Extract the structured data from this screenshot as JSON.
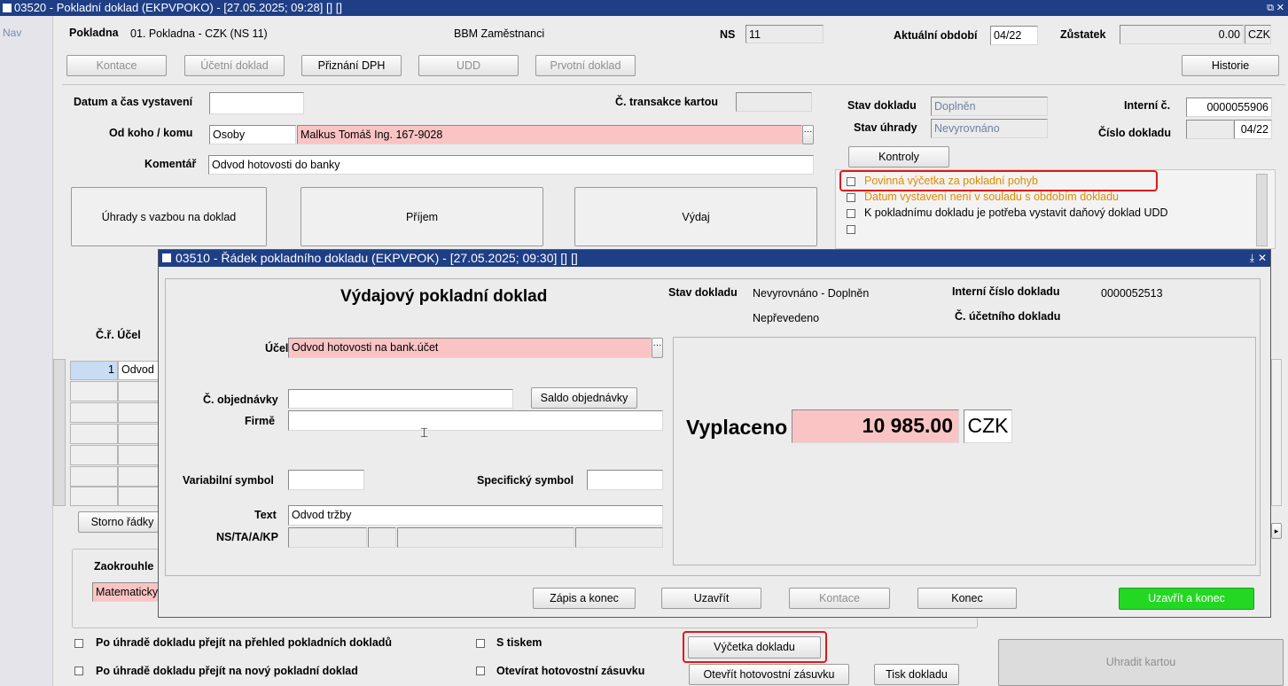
{
  "main": {
    "title": "03520 - Pokladní doklad (EKPVPOKO) - [27.05.2025; 09:28] [] []",
    "nav_label": "Nav",
    "pokladna_label": "Pokladna",
    "pokladna_value": "01. Pokladna - CZK (NS 11)",
    "group_value": "BBM Zaměstnanci",
    "ns_label": "NS",
    "ns_value": "11",
    "period_label": "Aktuální období",
    "period_value": "04/22",
    "balance_label": "Zůstatek",
    "balance_value": "0.00",
    "balance_currency": "CZK",
    "buttons": {
      "kontace": "Kontace",
      "ucetni_doklad": "Účetní doklad",
      "priznani_dph": "Přiznání DPH",
      "udd": "UDD",
      "prvotni_doklad": "Prvotní doklad",
      "historie": "Historie",
      "kontroly": "Kontroly",
      "uhrady": "Úhrady s vazbou na doklad",
      "prijem": "Příjem",
      "vydaj": "Výdaj",
      "storno": "Storno řádky",
      "vycetka": "Výčetka dokladu",
      "otevrit_zasuvku": "Otevřít hotovostní zásuvku",
      "tisk": "Tisk dokladu",
      "uhradit_kartou": "Uhradit kartou"
    },
    "datum_label": "Datum a čas vystavení",
    "datum_value": "",
    "transakce_label": "Č. transakce kartou",
    "od_koho_label": "Od koho / komu",
    "od_koho_type": "Osoby",
    "od_koho_value": "Malkus Tomáš Ing. 167-9028",
    "komentar_label": "Komentář",
    "komentar_value": "Odvod hotovosti do banky",
    "stav_dokladu_label": "Stav dokladu",
    "stav_dokladu_value": "Doplněn",
    "stav_uhrady_label": "Stav úhrady",
    "stav_uhrady_value": "Nevyrovnáno",
    "interni_label": "Interní č.",
    "interni_value": "0000055906",
    "cislo_label": "Číslo dokladu",
    "cislo_value": "04/22",
    "checks": [
      "Povinná výčetka za pokladní pohyb",
      "Datum vystavení není v souladu s obdobím dokladu",
      "K pokladnímu dokladu je potřeba vystavit daňový doklad UDD"
    ],
    "grid_header": "Č.ř. Účel",
    "grid_row1_no": "1",
    "grid_row1_text": "Odvod",
    "zaokrouhleni_label": "Zaokrouhle",
    "zaokrouhleni_value": "Matematicky",
    "opt1": "Po úhradě dokladu přejít na přehled pokladních dokladů",
    "opt2": "Po úhradě dokladu přejít na nový pokladní doklad",
    "opt3": "S tiskem",
    "opt4": "Otevírat hotovostní zásuvku"
  },
  "dialog": {
    "title": "03510 - Řádek pokladního dokladu (EKPVPOK) - [27.05.2025; 09:30] [] []",
    "heading": "Výdajový pokladní doklad",
    "stav_label": "Stav dokladu",
    "stav_value": "Nevyrovnáno - Doplněn",
    "stav_value2": "Nepřevedeno",
    "interni_label": "Interní číslo dokladu",
    "interni_value": "0000052513",
    "ucetni_label": "Č. účetního dokladu",
    "ucel_label": "Účel",
    "ucel_value": "Odvod hotovosti na bank.účet",
    "objednavka_label": "Č. objednávky",
    "saldo_button": "Saldo objednávky",
    "firme_label": "Firmě",
    "var_symbol_label": "Variabilní symbol",
    "spec_symbol_label": "Specifický symbol",
    "text_label": "Text",
    "text_value": "Odvod tržby",
    "ns_label": "NS/TA/A/KP",
    "amount_label": "Vyplaceno",
    "amount_value": "10 985.00",
    "amount_currency": "CZK",
    "buttons": {
      "zapis": "Zápis a konec",
      "uzavrit": "Uzavřít",
      "kontace": "Kontace",
      "konec": "Konec",
      "uzavrit_konec": "Uzavřít a konec"
    }
  },
  "colors": {
    "titlebar": "#1e3e86",
    "required_field": "#fbc4c4",
    "confirm_button": "#22d822",
    "highlight": "#e01818",
    "warning_text": "#e08a00"
  }
}
